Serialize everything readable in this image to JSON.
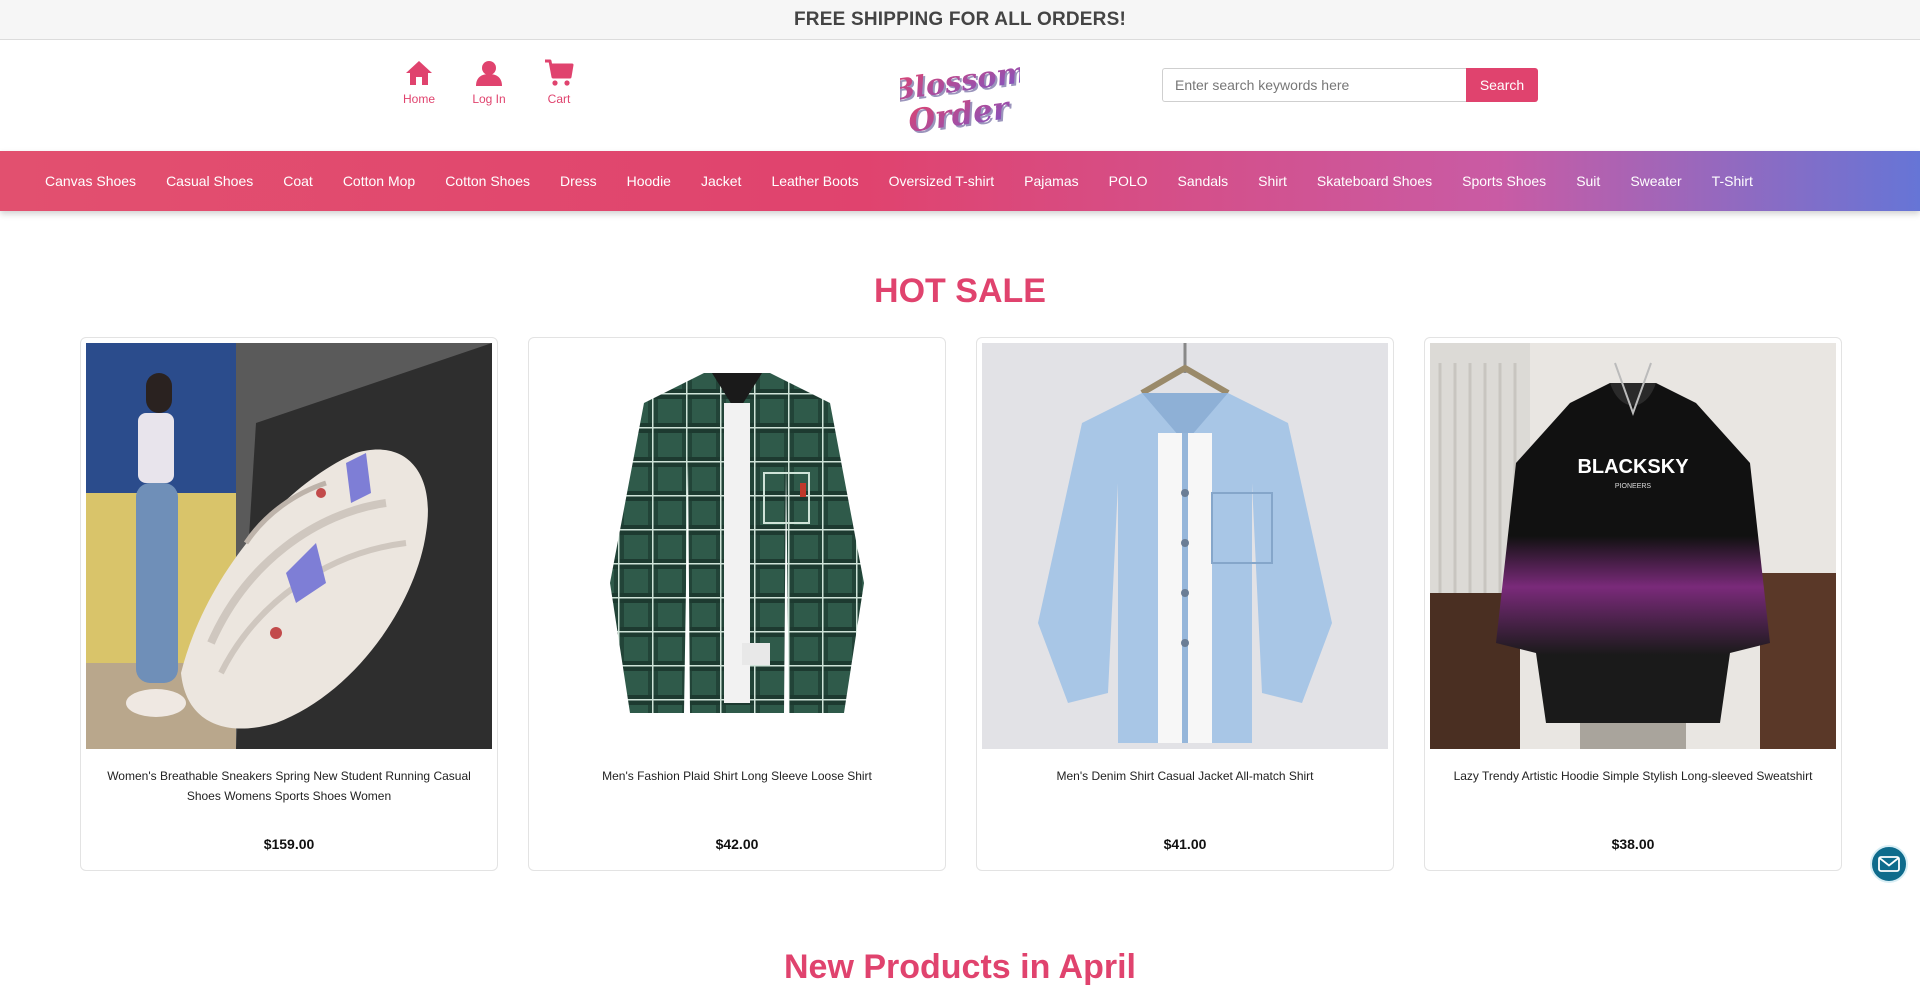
{
  "topbar": {
    "text": "FREE SHIPPING FOR ALL ORDERS!"
  },
  "header": {
    "quicklinks": [
      {
        "label": "Home",
        "icon": "home-icon"
      },
      {
        "label": "Log In",
        "icon": "user-icon"
      },
      {
        "label": "Cart",
        "icon": "cart-icon"
      }
    ],
    "logo": {
      "line1": "Blossom",
      "line2": "Order"
    },
    "search": {
      "placeholder": "Enter search keywords here",
      "button": "Search"
    }
  },
  "categories": [
    "Canvas Shoes",
    "Casual Shoes",
    "Coat",
    "Cotton Mop",
    "Cotton Shoes",
    "Dress",
    "Hoodie",
    "Jacket",
    "Leather Boots",
    "Oversized T-shirt",
    "Pajamas",
    "POLO",
    "Sandals",
    "Shirt",
    "Skateboard Shoes",
    "Sports Shoes",
    "Suit",
    "Sweater",
    "T-Shirt"
  ],
  "hot_sale": {
    "title": "HOT SALE",
    "products": [
      {
        "name": "Women's Breathable Sneakers Spring New Student Running Casual Shoes Womens Sports Shoes Women",
        "price": "$159.00",
        "image": "sneakers-photo"
      },
      {
        "name": "Men's Fashion Plaid Shirt Long Sleeve Loose Shirt",
        "price": "$42.00",
        "image": "plaid-shirt-photo"
      },
      {
        "name": "Men's Denim Shirt Casual Jacket All-match Shirt",
        "price": "$41.00",
        "image": "denim-shirt-photo"
      },
      {
        "name": "Lazy Trendy Artistic Hoodie Simple Stylish Long-sleeved Sweatshirt",
        "price": "$38.00",
        "image": "hoodie-photo",
        "print_text": "BLACKSKY",
        "print_sub": "PIONEERS"
      }
    ]
  },
  "new_products": {
    "title": "New Products in April"
  },
  "colors": {
    "accent": "#e0436e",
    "nav_end": "#6675d6",
    "mail": "#0e6b8c"
  }
}
